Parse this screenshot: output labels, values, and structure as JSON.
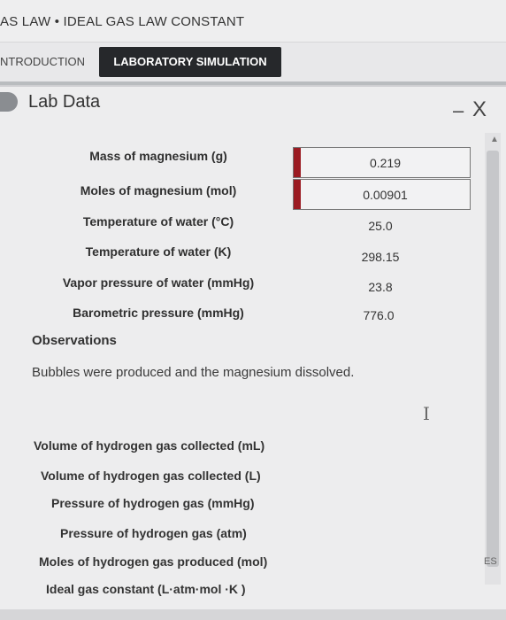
{
  "header": {
    "title": "AS LAW • IDEAL GAS LAW CONSTANT"
  },
  "tabs": [
    {
      "label": "NTRODUCTION",
      "active": false
    },
    {
      "label": "LABORATORY SIMULATION",
      "active": true
    }
  ],
  "panel": {
    "title": "Lab Data",
    "minimize_glyph": "–",
    "close_glyph": "X"
  },
  "lab_data": {
    "rows": [
      {
        "label": "Mass of magnesium (g)",
        "value": "0.219",
        "input": true
      },
      {
        "label": "Moles of magnesium (mol)",
        "value": "0.00901",
        "input": true
      },
      {
        "label": "Temperature of water (°C)",
        "value": "25.0",
        "input": false
      },
      {
        "label": "Temperature of water (K)",
        "value": "298.15",
        "input": false
      },
      {
        "label": "Vapor pressure of water (mmHg)",
        "value": "23.8",
        "input": false
      },
      {
        "label": "Barometric pressure (mmHg)",
        "value": "776.0",
        "input": false
      }
    ],
    "accent_color": "#9b1b22"
  },
  "observations": {
    "heading": "Observations",
    "text": "Bubbles were produced and the magnesium dissolved."
  },
  "calculations": [
    {
      "label": "Volume of hydrogen gas collected (mL)"
    },
    {
      "label": "Volume of hydrogen gas collected (L)"
    },
    {
      "label": "Pressure of hydrogen gas (mmHg)"
    },
    {
      "label": "Pressure of hydrogen gas (atm)"
    },
    {
      "label": "Moles of hydrogen gas produced (mol)"
    },
    {
      "label": "Ideal gas constant (L·atm·mol ·K )"
    }
  ],
  "side": {
    "edge_label": "ES"
  }
}
